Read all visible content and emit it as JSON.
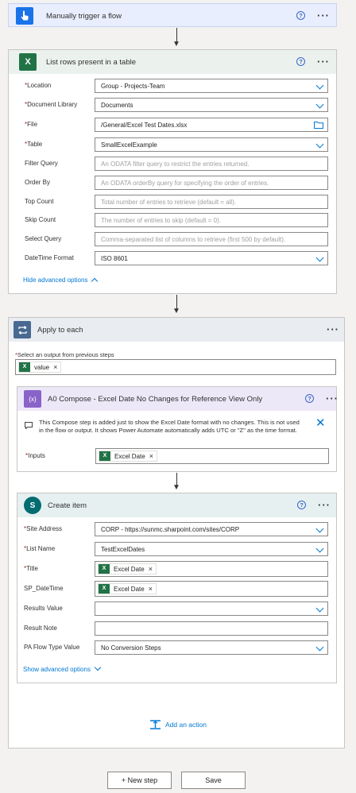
{
  "trigger": {
    "title": "Manually trigger a flow",
    "help": "?",
    "more": "···"
  },
  "list_rows": {
    "title": "List rows present in a table",
    "help": "?",
    "more": "···",
    "fields": {
      "location": {
        "label": "Location",
        "value": "Group -  Projects-Team"
      },
      "document_library": {
        "label": "Document Library",
        "value": "Documents"
      },
      "file": {
        "label": "File",
        "value": "/General/Excel Test Dates.xlsx"
      },
      "table": {
        "label": "Table",
        "value": "SmallExcelExample"
      },
      "filter_query": {
        "label": "Filter Query",
        "placeholder": "An ODATA filter query to restrict the entries returned."
      },
      "order_by": {
        "label": "Order By",
        "placeholder": "An ODATA orderBy query for specifying the order of entries."
      },
      "top_count": {
        "label": "Top Count",
        "placeholder": "Total number of entries to retrieve (default = all)."
      },
      "skip_count": {
        "label": "Skip Count",
        "placeholder": "The number of entries to skip (default = 0)."
      },
      "select_query": {
        "label": "Select Query",
        "placeholder": "Comma-separated list of columns to retrieve (first 500 by default)."
      },
      "datetime_format": {
        "label": "DateTime Format",
        "value": "ISO 8601"
      }
    },
    "hide_advanced": "Hide advanced options"
  },
  "apply_each": {
    "title": "Apply to each",
    "more": "···",
    "select_label": "Select an output from previous steps",
    "token": "value"
  },
  "compose": {
    "title": "A0 Compose - Excel Date No Changes for Reference View Only",
    "help": "?",
    "more": "···",
    "note": "This Compose step is added just to show the Excel Date format with no changes. This is not used in the flow or output. It shows Power Automate automatically adds UTC or \"Z\" as the time format.",
    "inputs_label": "Inputs",
    "inputs_token": "Excel Date"
  },
  "create_item": {
    "title": "Create item",
    "help": "?",
    "more": "···",
    "fields": {
      "site_address": {
        "label": "Site Address",
        "value": "CORP - https://sunmc.sharpoint.com/sites/CORP"
      },
      "list_name": {
        "label": "List Name",
        "value": "TestExcelDates"
      },
      "title": {
        "label": "Title",
        "token": "Excel Date"
      },
      "sp_datetime": {
        "label": "SP_DateTime",
        "token": "Excel Date"
      },
      "results_value": {
        "label": "Results Value",
        "value": ""
      },
      "result_note": {
        "label": "Result Note",
        "value": ""
      },
      "pa_flow_type": {
        "label": "PA Flow Type Value",
        "value": "No Conversion Steps"
      }
    },
    "show_advanced": "Show advanced options"
  },
  "add_action": "Add an action",
  "footer": {
    "new_step": "+ New step",
    "save": "Save"
  },
  "colors": {
    "trigger_head": "#e8eefd",
    "excel_head": "#ebf2ee",
    "apply_head": "#e9ecf1",
    "compose_head": "#ede8f8",
    "sharepoint_head": "#e6f0f1",
    "accent": "#0078d4",
    "required": "#a4262c"
  }
}
